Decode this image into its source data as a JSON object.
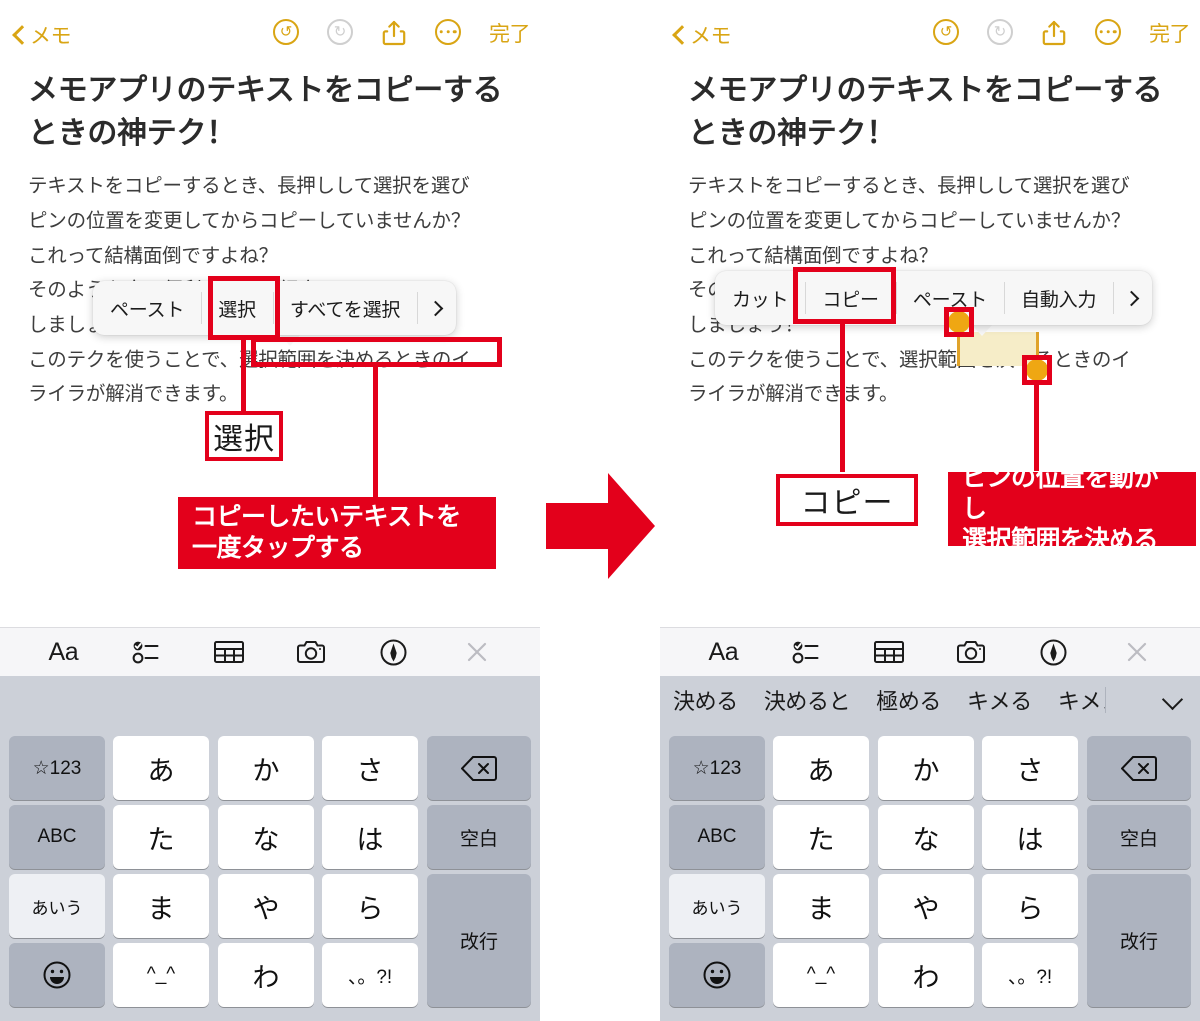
{
  "nav": {
    "back_label": "メモ",
    "done_label": "完了",
    "undo_icon": "undo-icon",
    "redo_icon": "redo-icon",
    "share_icon": "share-icon",
    "more_icon": "more-ellipsis-icon"
  },
  "note": {
    "title": "メモアプリのテキストをコピーするときの神テク！",
    "paragraphs": [
      "テキストをコピーするとき、長押しして選択を選び",
      "ピンの位置を変更してからコピーしていませんか？",
      "これって結構面倒ですよね？",
      "そのような方に便利なテクを紹介",
      "しましょう！",
      "このテクを使うことで、選択範囲を決めるときのイ",
      "ライラが解消できます。"
    ]
  },
  "left_panel": {
    "context_menu": {
      "items": [
        "ペースト",
        "選択",
        "すべてを選択"
      ],
      "more_arrow": "chevron-right-icon",
      "highlighted_item": "選択"
    },
    "annotations": {
      "callout_label": "選択",
      "banner_lines": [
        "コピーしたいテキストを",
        "一度タップする"
      ],
      "boxed_text": "選択範囲を決めるときのイ"
    }
  },
  "right_panel": {
    "context_menu": {
      "items": [
        "カット",
        "コピー",
        "ペースト",
        "自動入力"
      ],
      "more_arrow": "chevron-right-icon",
      "highlighted_item": "コピー"
    },
    "selection": {
      "selected_text": "決める",
      "start_pin": "selection-pin-start",
      "end_pin": "selection-pin-end"
    },
    "annotations": {
      "callout_label": "コピー",
      "banner_lines": [
        "ピンの位置を動かし",
        "選択範囲を決める"
      ]
    }
  },
  "keyboard": {
    "toolbar_icons": [
      "text-format-icon",
      "checklist-icon",
      "table-icon",
      "camera-icon",
      "markup-pen-icon",
      "close-icon"
    ],
    "suggestions": [
      "決める",
      "決めると",
      "極める",
      "キメる",
      "キメノ"
    ],
    "suggestion_expand_icon": "chevron-down-icon",
    "rows": [
      [
        {
          "label": "☆123",
          "style": "gray",
          "size": "sm"
        },
        {
          "label": "あ",
          "style": "white",
          "size": "lg"
        },
        {
          "label": "か",
          "style": "white",
          "size": "lg"
        },
        {
          "label": "さ",
          "style": "white",
          "size": "lg"
        },
        {
          "label": "backspace-icon",
          "style": "gray",
          "size": "icon"
        }
      ],
      [
        {
          "label": "ABC",
          "style": "gray",
          "size": "sm"
        },
        {
          "label": "た",
          "style": "white",
          "size": "lg"
        },
        {
          "label": "な",
          "style": "white",
          "size": "lg"
        },
        {
          "label": "は",
          "style": "white",
          "size": "lg"
        },
        {
          "label": "空白",
          "style": "gray",
          "size": "sm"
        }
      ],
      [
        {
          "label": "あいう",
          "style": "light",
          "size": "xs"
        },
        {
          "label": "ま",
          "style": "white",
          "size": "lg"
        },
        {
          "label": "や",
          "style": "white",
          "size": "lg"
        },
        {
          "label": "ら",
          "style": "white",
          "size": "lg"
        },
        {
          "label": "改行",
          "style": "gray",
          "size": "sm"
        }
      ],
      [
        {
          "label": "emoji-icon",
          "style": "gray",
          "size": "icon"
        },
        {
          "label": "^_^",
          "style": "white",
          "size": "sm"
        },
        {
          "label": "わ",
          "style": "white",
          "size": "lg"
        },
        {
          "label": "、。?!",
          "style": "white",
          "size": "sm"
        },
        {
          "label": "",
          "style": "gray",
          "size": "sm"
        }
      ]
    ]
  },
  "transition": {
    "arrow_icon": "right-arrow-icon",
    "arrow_color": "#e3001b"
  },
  "colors": {
    "accent": "#d9a514",
    "annotation_red": "#e3001b",
    "selection_highlight": "#f6edc8",
    "pin": "#efa713",
    "keyboard_bg": "#ccd0d8"
  }
}
